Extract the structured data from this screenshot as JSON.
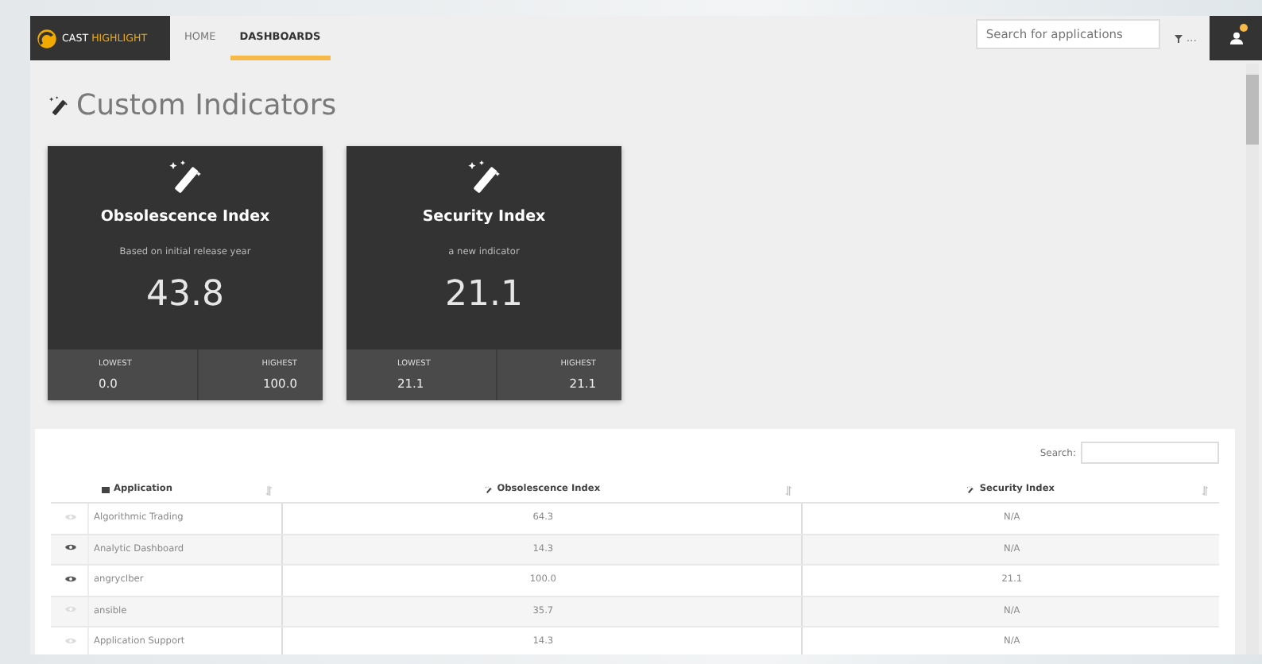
{
  "header": {
    "logo": "CAST HIGHLIGHT",
    "nav": [
      {
        "label": "HOME",
        "selected": false
      },
      {
        "label": "DASHBOARDS",
        "selected": true
      }
    ],
    "search": {
      "placeholder": "Search for applications"
    },
    "filter_label": "...",
    "notification": true
  },
  "page_title": "Custom Indicators",
  "cards": [
    {
      "title": "Obsolescence Index",
      "subtitle": "Based on initial release year",
      "value": "43.8",
      "lowest_label": "LOWEST",
      "lowest": "0.0",
      "highest_label": "HIGHEST",
      "highest": "100.0"
    },
    {
      "title": "Security Index",
      "subtitle": "a new indicator",
      "value": "21.1",
      "lowest_label": "LOWEST",
      "lowest": "21.1",
      "highest_label": "HIGHEST",
      "highest": "21.1"
    }
  ],
  "table": {
    "search_label": "Search:",
    "columns": [
      "Application",
      "Obsolescence Index",
      "Security Index"
    ],
    "rows": [
      {
        "followed": false,
        "cells": [
          "Algorithmic Trading",
          "64.3",
          "N/A"
        ]
      },
      {
        "followed": true,
        "cells": [
          "Analytic Dashboard",
          "14.3",
          "N/A"
        ]
      },
      {
        "followed": true,
        "cells": [
          "angrycIber",
          "100.0",
          "21.1"
        ]
      },
      {
        "followed": false,
        "cells": [
          "ansible",
          "35.7",
          "N/A"
        ]
      },
      {
        "followed": false,
        "cells": [
          "Application Support",
          "14.3",
          "N/A"
        ]
      }
    ]
  }
}
